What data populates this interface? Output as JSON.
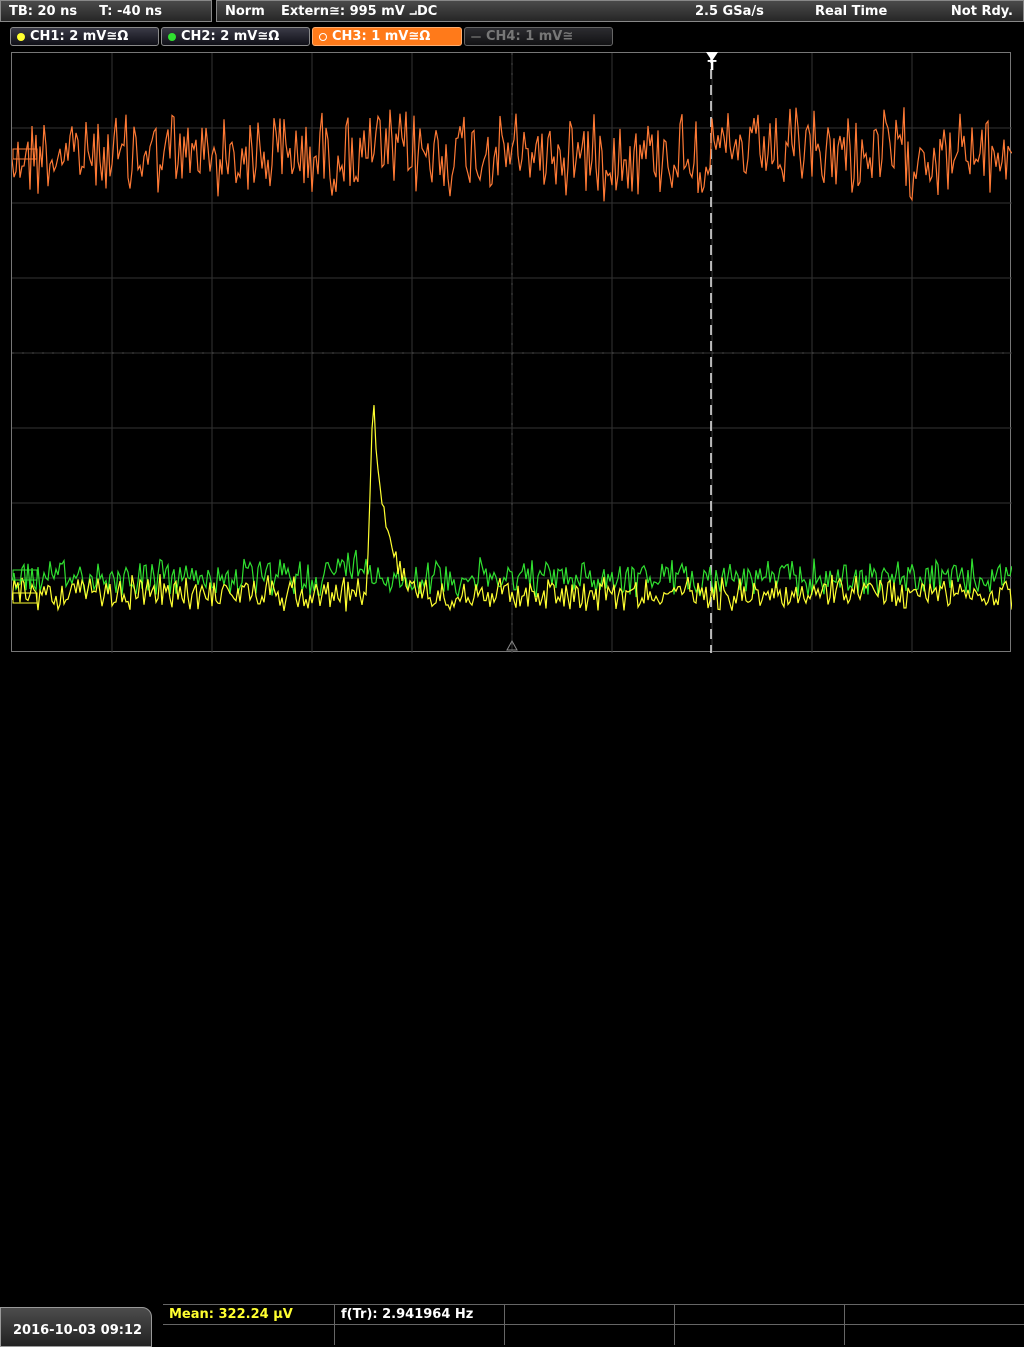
{
  "header": {
    "timebase": "TB: 20 ns",
    "trigger_time": "T: -40 ns",
    "mode": "Norm",
    "trigger_source": "Extern≅: 995 mV ⨼DC",
    "sample_rate": "2.5 GSa/s",
    "acquisition": "Real Time",
    "status": "Not Rdy."
  },
  "channels": [
    {
      "label": "CH1: 2 mV≅Ω",
      "color": "#ffff30",
      "state": "on"
    },
    {
      "label": "CH2: 2 mV≅Ω",
      "color": "#30e030",
      "state": "on"
    },
    {
      "label": "CH3: 1 mV≅Ω",
      "color": "#ff7a1a",
      "state": "active"
    },
    {
      "label": "CH4: 1 mV≅",
      "color": "#777777",
      "state": "off"
    }
  ],
  "trigger_marker": "T",
  "footer": {
    "datetime": "2016-10-03 09:12",
    "meas1": "Mean: 322.24 µV",
    "meas2": "f(Tr): 2.941964 Hz"
  },
  "colors": {
    "ch1_trace": "#ffff30",
    "ch2_trace": "#30e030",
    "ch3_trace": "#ff7a35",
    "grid": "#3a3a3a"
  }
}
